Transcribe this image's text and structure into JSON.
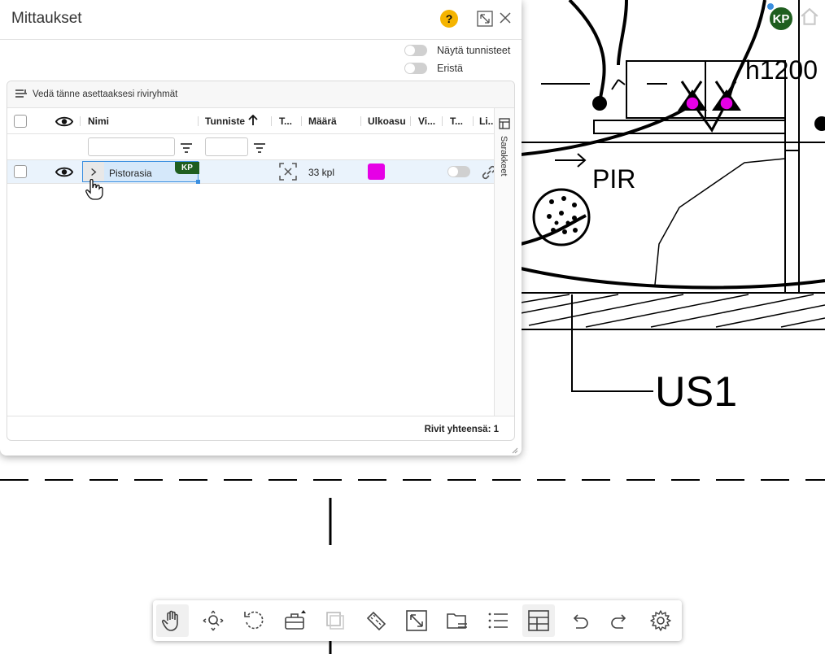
{
  "panel": {
    "title": "Mittaukset",
    "help_label": "?",
    "toggles": [
      {
        "label": "Näytä tunnisteet",
        "on": false
      },
      {
        "label": "Eristä",
        "on": false
      }
    ]
  },
  "grid": {
    "group_hint": "Vedä tänne asettaaksesi riviryhmät",
    "columns": [
      {
        "label": "Nimi"
      },
      {
        "label": "Tunniste",
        "sort": "ascending"
      },
      {
        "label": "T..."
      },
      {
        "label": "Määrä"
      },
      {
        "label": "Ulkoasu"
      },
      {
        "label": "Vi..."
      },
      {
        "label": "T..."
      },
      {
        "label": "Li..."
      }
    ],
    "rows": [
      {
        "name": "Pistorasia",
        "badge": "KP",
        "quantity": "33 kpl",
        "appearance_color": "#e600e6",
        "visible": true,
        "toggle_on": false
      }
    ],
    "side_label": "Sarakkeet",
    "footer": "Rivit yhteensä: 1"
  },
  "user": {
    "initials": "KP"
  },
  "drawing": {
    "labels": {
      "height_tag": "h1200",
      "sensor": "PIR",
      "unit": "US1"
    }
  },
  "toolbar": {
    "tools": [
      {
        "icon": "pan-hand-icon",
        "active": true
      },
      {
        "icon": "zoom-navigate-icon",
        "active": false
      },
      {
        "icon": "rotate-icon",
        "active": false
      },
      {
        "icon": "toolbox-icon",
        "active": false
      },
      {
        "icon": "layers-icon",
        "active": false,
        "disabled": true
      },
      {
        "icon": "measure-tape-icon",
        "active": false
      },
      {
        "icon": "fit-view-icon",
        "active": false
      },
      {
        "icon": "folder-icon",
        "active": false
      },
      {
        "icon": "list-icon",
        "active": false
      },
      {
        "icon": "table-icon",
        "active": true
      },
      {
        "icon": "undo-icon",
        "active": false
      },
      {
        "icon": "redo-icon",
        "active": false
      },
      {
        "icon": "settings-icon",
        "active": false
      }
    ]
  }
}
